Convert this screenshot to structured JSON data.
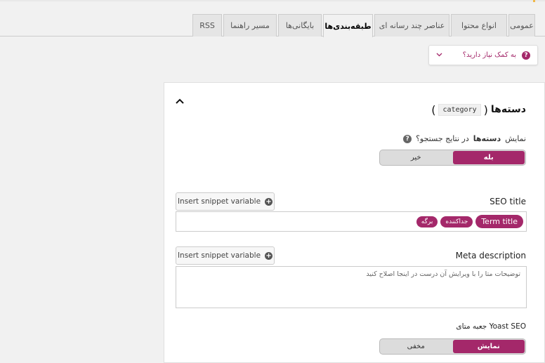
{
  "tabs": [
    {
      "label": "عمومی",
      "active": false
    },
    {
      "label": "انواع محتوا",
      "active": false
    },
    {
      "label": "عناصر چند رسانه ای",
      "active": false
    },
    {
      "label": "طبقه‌بندی‌ها",
      "active": true
    },
    {
      "label": "بایگانی‌ها",
      "active": false
    },
    {
      "label": "مسیر راهنما",
      "active": false
    },
    {
      "label": "RSS",
      "active": false
    }
  ],
  "help": {
    "label": "به کمک نیاز دارید؟",
    "icon": "question-icon",
    "chevron": "chevron-down-icon"
  },
  "section": {
    "title": "دسته‌ها",
    "code": "category",
    "collapse_icon": "chevron-up-icon"
  },
  "search_visibility": {
    "question_prefix": "نمایش",
    "question_bold": "دسته‌ها",
    "question_suffix": "در نتایج جستجو؟",
    "yes": "بله",
    "no": "خیر",
    "selected": "yes"
  },
  "seo_title": {
    "label": "SEO title",
    "snippet_button": "Insert snippet variable",
    "variables": [
      "Term title",
      "جداکننده",
      "برگه"
    ]
  },
  "meta_description": {
    "label": "Meta description",
    "snippet_button": "Insert snippet variable",
    "placeholder": "توضیحات متا را با ویرایش آن درست در اینجا اصلاح کنید"
  },
  "yoast_box": {
    "label": "جعبه متای Yoast SEO",
    "show": "نمایش",
    "hide": "مخفی",
    "selected": "show"
  },
  "colors": {
    "accent": "#a4286a"
  }
}
